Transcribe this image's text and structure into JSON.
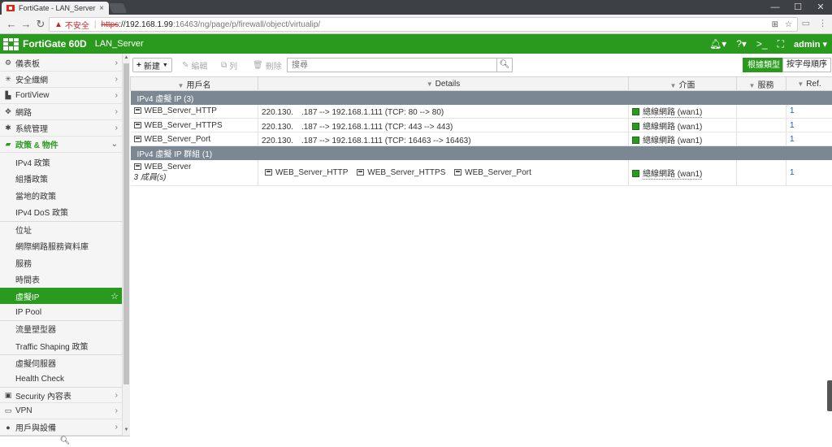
{
  "browser": {
    "tab_title": "FortiGate - LAN_Server",
    "tab_close": "×",
    "win_min": "—",
    "win_max": "☐",
    "win_close": "✕",
    "insecure_label": "不安全",
    "url_scheme": "https",
    "url_host": "://192.168.1.99",
    "url_rest": ":16463/ng/page/p/firewall/object/virtualip/"
  },
  "header": {
    "model": "FortiGate 60D",
    "hostname": "LAN_Server",
    "user": "admin"
  },
  "sidebar": {
    "items": [
      {
        "icon": "dashboard-icon",
        "glyph": "⚙",
        "label": "儀表板"
      },
      {
        "icon": "security-fabric-icon",
        "glyph": "✳",
        "label": "安全織網"
      },
      {
        "icon": "fortiview-icon",
        "glyph": "▙",
        "label": "FortiView"
      },
      {
        "icon": "network-icon",
        "glyph": "✥",
        "label": "網路"
      },
      {
        "icon": "system-icon",
        "glyph": "✱",
        "label": "系統管理"
      },
      {
        "icon": "policy-icon",
        "glyph": "▰",
        "label": "政策 & 物件"
      }
    ],
    "subitems": [
      "IPv4 政策",
      "組播政策",
      "當地的政策",
      "IPv4 DoS 政策",
      "位址",
      "網際網路服務資料庫",
      "服務",
      "時間表",
      "虛擬IP",
      "IP Pool",
      "流量塑型器",
      "Traffic Shaping 政策",
      "虛擬伺服器",
      "Health Check"
    ],
    "bottom_items": [
      {
        "icon": "security-profiles-icon",
        "glyph": "▣",
        "label": "Security 內容表"
      },
      {
        "icon": "vpn-icon",
        "glyph": "▭",
        "label": "VPN"
      },
      {
        "icon": "user-device-icon",
        "glyph": "●",
        "label": "用戶與設備"
      }
    ]
  },
  "toolbar": {
    "new_label": "新建",
    "edit_label": "編輯",
    "list_label": "列",
    "delete_label": "刪除",
    "search_placeholder": "搜尋",
    "group_by_type": "根據類型",
    "alphabetical": "按字母順序"
  },
  "table": {
    "columns": [
      "用戶名",
      "Details",
      "介面",
      "服務",
      "Ref."
    ],
    "groups": [
      {
        "title": "IPv4 虛擬 IP (3)",
        "rows": [
          {
            "name": "WEB_Server_HTTP",
            "details": "220.130.　.187 --> 192.168.1.111 (TCP: 80 --> 80)",
            "interface": "總線網路 (wan1)",
            "service": "",
            "ref": "1"
          },
          {
            "name": "WEB_Server_HTTPS",
            "details": "220.130.　.187 --> 192.168.1.111 (TCP: 443 --> 443)",
            "interface": "總線網路 (wan1)",
            "service": "",
            "ref": "1"
          },
          {
            "name": "WEB_Server_Port",
            "details": "220.130.　.187 --> 192.168.1.111 (TCP: 16463 --> 16463)",
            "interface": "總線網路 (wan1)",
            "service": "",
            "ref": "1"
          }
        ]
      },
      {
        "title": "IPv4 虛擬 IP 群組 (1)",
        "group_row": {
          "name": "WEB_Server",
          "members_count": "3 成員(s)",
          "members": [
            "WEB_Server_HTTP",
            "WEB_Server_HTTPS",
            "WEB_Server_Port"
          ],
          "interface": "總線網路 (wan1)",
          "ref": "1"
        }
      }
    ]
  },
  "colors": {
    "fortinet_green": "#2a9a1f",
    "group_header": "#7b8893"
  }
}
